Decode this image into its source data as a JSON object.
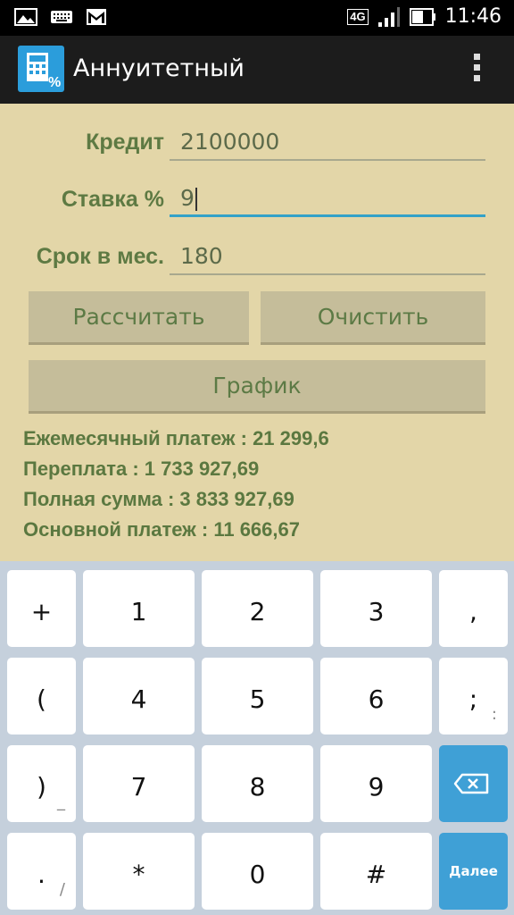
{
  "status_bar": {
    "network": "4G",
    "time": "11:46"
  },
  "app": {
    "title": "Аннуитетный"
  },
  "form": {
    "credit_label": "Кредит",
    "credit_value": "2100000",
    "rate_label": "Ставка %",
    "rate_value": "9",
    "term_label": "Срок в мес.",
    "term_value": "180"
  },
  "buttons": {
    "calculate": "Рассчитать",
    "clear": "Очистить",
    "schedule": "График"
  },
  "results": {
    "monthly": "Ежемесячный платеж : 21 299,6",
    "overpay": "Переплата : 1 733 927,69",
    "total": "Полная сумма : 3 833 927,69",
    "principal": "Основной платеж : 11 666,67"
  },
  "keyboard": {
    "rows": [
      [
        {
          "main": "+",
          "hint": ""
        },
        {
          "main": "1",
          "hint": ""
        },
        {
          "main": "2",
          "hint": ""
        },
        {
          "main": "3",
          "hint": ""
        },
        {
          "main": ",",
          "hint": ""
        }
      ],
      [
        {
          "main": "(",
          "hint": ""
        },
        {
          "main": "4",
          "hint": ""
        },
        {
          "main": "5",
          "hint": ""
        },
        {
          "main": "6",
          "hint": ""
        },
        {
          "main": ";",
          "hint": ":"
        }
      ],
      [
        {
          "main": ")",
          "hint": "_"
        },
        {
          "main": "7",
          "hint": ""
        },
        {
          "main": "8",
          "hint": ""
        },
        {
          "main": "9",
          "hint": ""
        },
        {
          "main": "",
          "hint": ""
        }
      ],
      [
        {
          "main": ".",
          "hint": "/"
        },
        {
          "main": "*",
          "hint": ""
        },
        {
          "main": "0",
          "hint": ""
        },
        {
          "main": "#",
          "hint": ""
        },
        {
          "main": "Далее",
          "hint": ""
        }
      ]
    ]
  },
  "colors": {
    "background": "#e3d6a8",
    "accent": "#33a2c8",
    "label": "#5e7a43"
  }
}
